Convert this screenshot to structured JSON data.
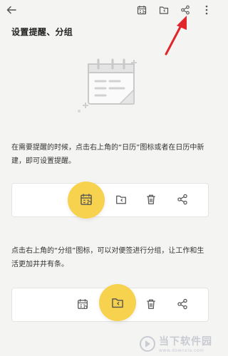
{
  "title": "设置提醒、分组",
  "instructions": {
    "reminder_text": "在需要提醒的时候，点击右上角的“日历”图标或者在日历中新建，即可设置提醒。",
    "group_text": "点击右上角的“分组”图标，可以对便签进行分组，让工作和生活更加井井有条。"
  },
  "toolbar": {
    "icons": [
      "back-icon",
      "calendar-icon",
      "folder-icon",
      "share-icon",
      "more-icon"
    ]
  },
  "colors": {
    "highlight": "#f7d24e",
    "arrow": "#e0262b",
    "icon": "#555555"
  },
  "watermark": {
    "text": "当下软件园",
    "sub": "www.downxia.com"
  }
}
